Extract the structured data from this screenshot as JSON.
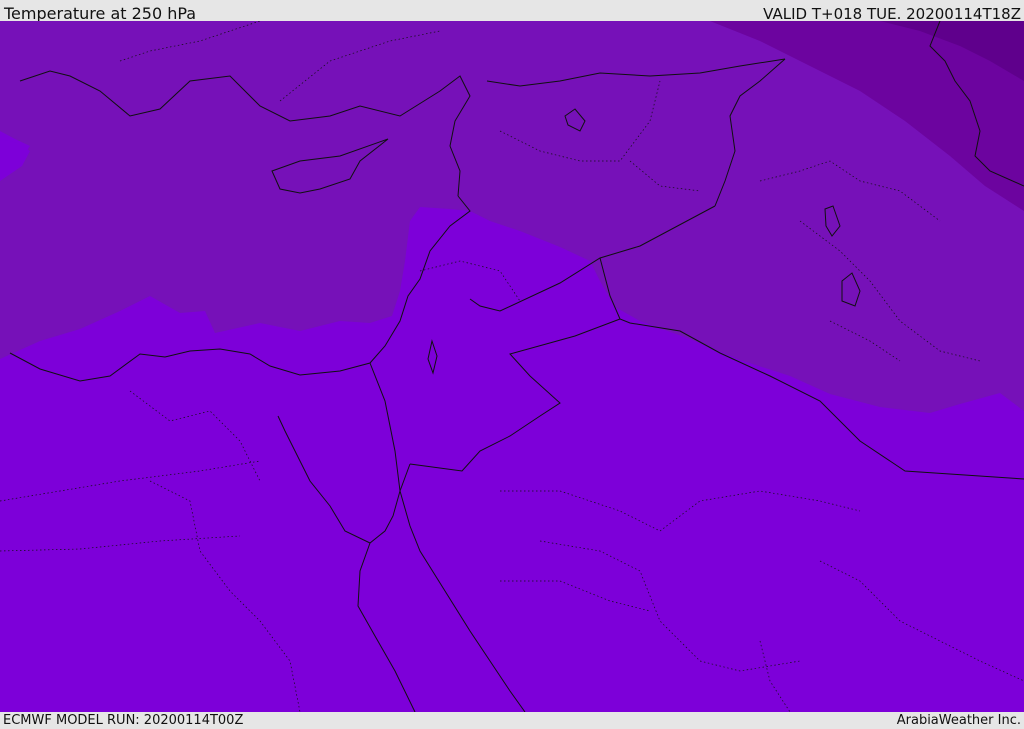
{
  "header": {
    "title": "Temperature at 250 hPa",
    "valid": "VALID T+018 TUE. 20200114T18Z"
  },
  "footer": {
    "model_run": "ECMWF MODEL RUN: 20200114T00Z",
    "credit": "ArabiaWeather Inc."
  },
  "colors": {
    "band_warm": "#7d00d9",
    "band_mid": "#7611b8",
    "band_cool": "#6c049f",
    "band_coldest": "#5f008c",
    "coast_line": "#101010"
  }
}
